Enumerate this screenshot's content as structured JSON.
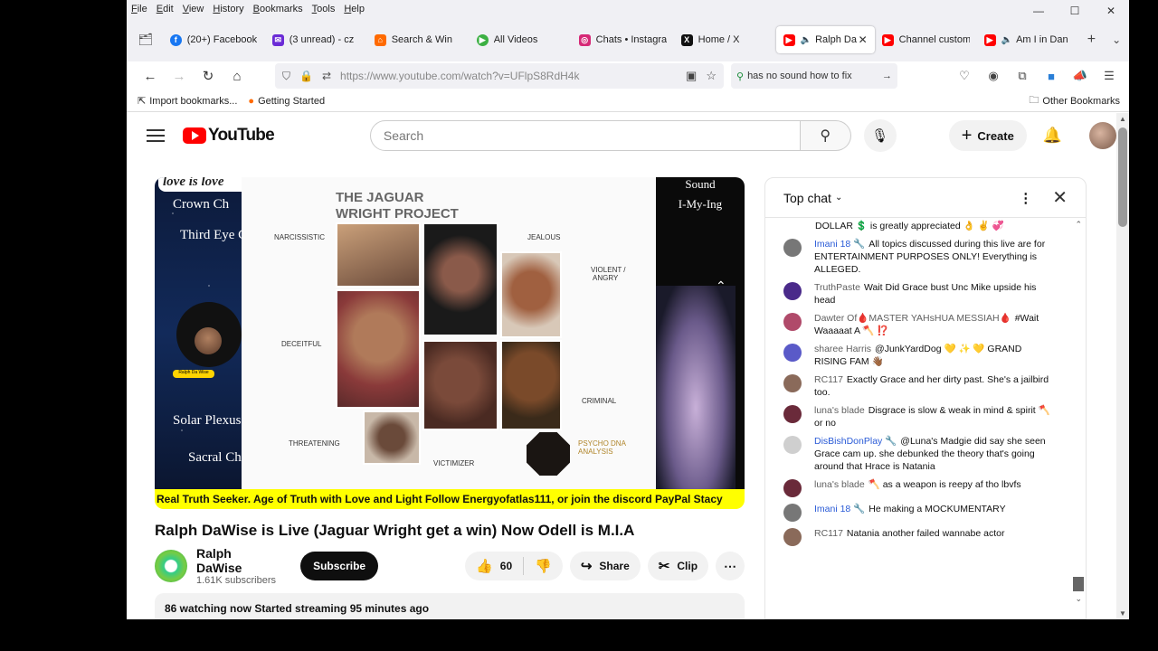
{
  "menubar": [
    "File",
    "Edit",
    "View",
    "History",
    "Bookmarks",
    "Tools",
    "Help"
  ],
  "tabs": [
    {
      "label": "(20+) Facebook",
      "color": "#1877f2",
      "glyph": "f"
    },
    {
      "label": "(3 unread) - cz",
      "color": "#6b2bd6",
      "glyph": "✉"
    },
    {
      "label": "Search & Win",
      "color": "#ff6a00",
      "glyph": "⌂"
    },
    {
      "label": "All Videos",
      "color": "#3cb043",
      "glyph": "▶"
    },
    {
      "label": "Chats • Instagra",
      "color": "#d62976",
      "glyph": "◎"
    },
    {
      "label": "Home / X",
      "color": "#111111",
      "glyph": "X"
    },
    {
      "label": "Ralph Da",
      "color": "#ff0000",
      "glyph": "▶",
      "active": true
    },
    {
      "label": "Channel custom",
      "color": "#ff0000",
      "glyph": "▶"
    },
    {
      "label": "Am I in Dan",
      "color": "#ff0000",
      "glyph": "▶"
    }
  ],
  "nav": {
    "url": "https://www.youtube.com/watch?v=UFlpS8RdH4k",
    "search_text": "has no sound how to fix"
  },
  "bookmarks": {
    "import": "Import bookmarks...",
    "getting_started": "Getting Started",
    "other": "Other Bookmarks"
  },
  "yt": {
    "logo": "YouTube",
    "search_placeholder": "Search",
    "create": "Create"
  },
  "video": {
    "love": "love is love",
    "left_texts": [
      "Crown Ch",
      "Third Eye C",
      "Solar Plexus",
      "Sacral Ch"
    ],
    "tag": "Ralph Da Wise",
    "project_title_1": "THE JAGUAR",
    "project_title_2": "WRIGHT PROJECT",
    "labels": {
      "narcissistic": "NARCISSISTIC",
      "jealous": "JEALOUS",
      "violent": "VIOLENT /",
      "angry": "ANGRY",
      "deceitful": "DECEITFUL",
      "criminal": "CRIMINAL",
      "threatening": "THREATENING",
      "victimizer": "VICTIMIZER",
      "psycho1": "PSYCHO DNA",
      "psycho2": "ANALYSIS"
    },
    "right_texts": [
      "Sound",
      "I-My-Ing"
    ],
    "ticker": "Real Truth Seeker. Age of Truth with Love and Light Follow Energyofatlas111, or join the discord PayPal Stacy"
  },
  "title": "Ralph DaWise is Live (Jaguar Wright get a win) Now Odell is M.I.A",
  "channel": {
    "name": "Ralph DaWise",
    "subs": "1.61K subscribers",
    "subscribe": "Subscribe",
    "likes": "60",
    "share": "Share",
    "clip": "Clip"
  },
  "desc": "86 watching now  Started streaming 95 minutes ago",
  "chat": {
    "header": "Top chat",
    "first_line": "DOLLAR 💲  is greatly appreciated 👌 ✌️ 💞",
    "messages": [
      {
        "author": "Imani 18 🔧",
        "mod": true,
        "text": "All topics discussed during this live are for ENTERTAINMENT PURPOSES ONLY! Everything is ALLEGED.",
        "avatar": "#777777"
      },
      {
        "author": "TruthPaste",
        "mod": false,
        "text": "Wait Did Grace bust Unc Mike upside his head",
        "avatar": "#4a2a8a"
      },
      {
        "author": "Dawter Of🩸MASTER YAHsHUA MESSIAH🩸",
        "mod": false,
        "text": "#Wait Waaaaat A 🪓 ⁉️",
        "avatar": "#b04a6a"
      },
      {
        "author": "sharee Harris",
        "mod": false,
        "text": "@JunkYardDog 💛 ✨ 💛 GRAND RISING FAM 👋🏾",
        "avatar": "#5a5ac8"
      },
      {
        "author": "RC117",
        "mod": false,
        "text": "Exactly Grace and her dirty past. She's a jailbird too.",
        "avatar": "#8a6a5a"
      },
      {
        "author": "luna's blade",
        "mod": false,
        "text": "Disgrace is slow & weak in mind & spirit 🪓 or no",
        "avatar": "#6a2a3a"
      },
      {
        "author": "DisBishDonPlay 🔧",
        "mod": true,
        "text": "@Luna's Madgie did say she seen Grace cam up. she debunked the theory that's going around that Hrace is Natania",
        "avatar": "#cfcfcf"
      },
      {
        "author": "luna's blade",
        "mod": false,
        "text": "🪓 as a weapon is reepy af tho lbvfs",
        "avatar": "#6a2a3a"
      },
      {
        "author": "Imani 18 🔧",
        "mod": true,
        "text": "He making a MOCKUMENTARY",
        "avatar": "#777777"
      },
      {
        "author": "RC117",
        "mod": false,
        "text": "Natania another failed wannabe actor",
        "avatar": "#8a6a5a"
      }
    ]
  }
}
